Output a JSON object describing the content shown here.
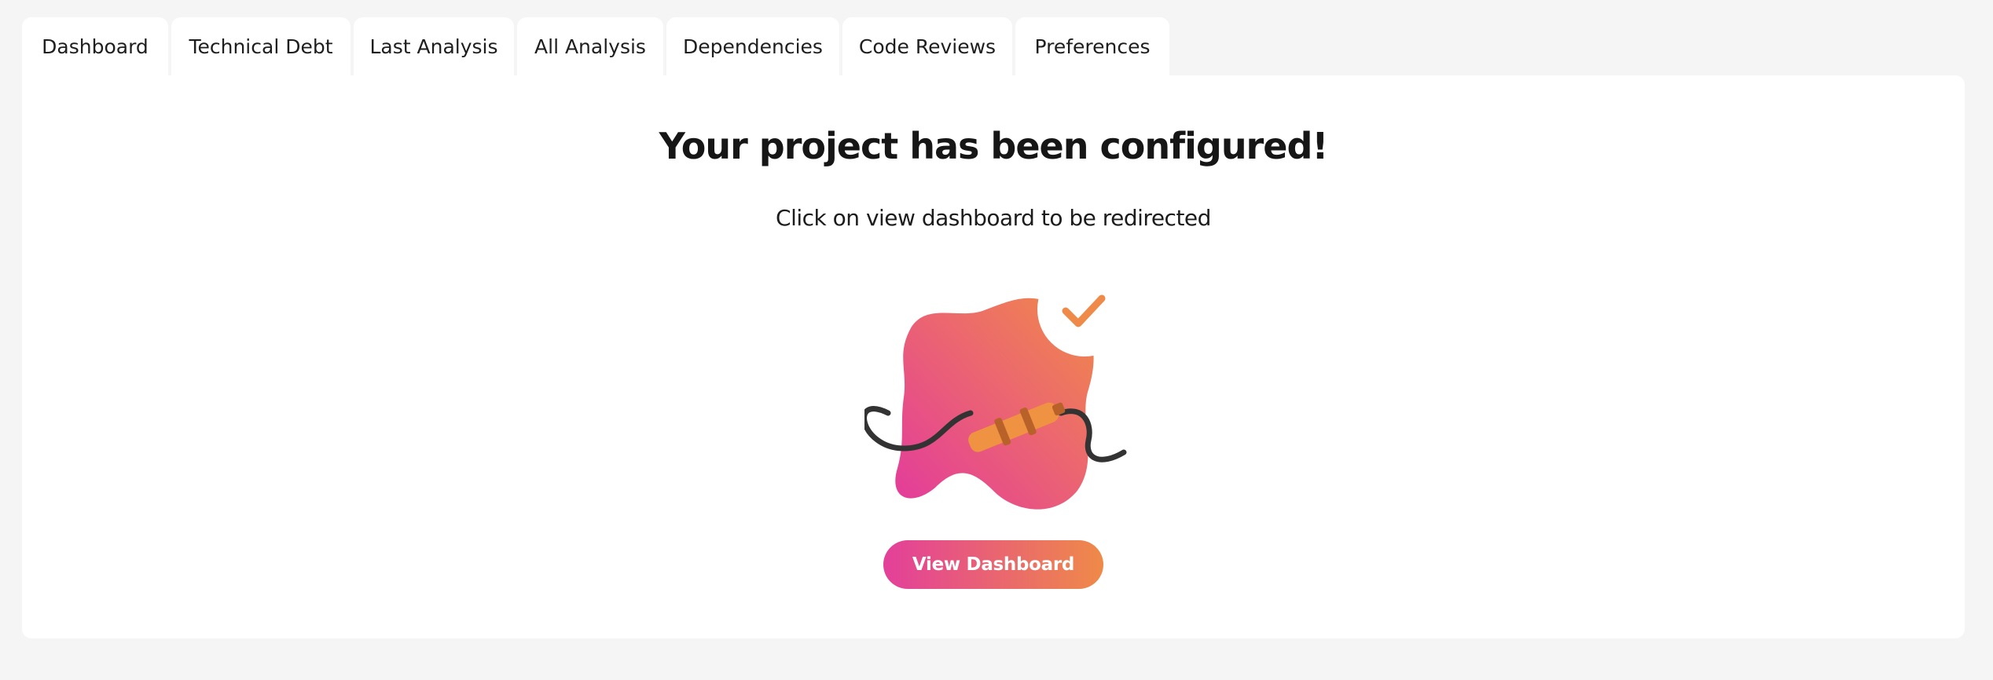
{
  "tabs": [
    {
      "label": "Dashboard"
    },
    {
      "label": "Technical Debt"
    },
    {
      "label": "Last Analysis"
    },
    {
      "label": "All Analysis"
    },
    {
      "label": "Dependencies"
    },
    {
      "label": "Code Reviews"
    },
    {
      "label": "Preferences"
    }
  ],
  "main": {
    "title": "Your project has been configured!",
    "subtitle": "Click on view dashboard to be redirected",
    "button_label": "View Dashboard"
  },
  "illustration": {
    "icon": "plugged-cable-checkmark-icon"
  },
  "colors": {
    "page_background": "#f5f5f5",
    "panel_background": "#ffffff",
    "gradient_start": "#e33f9a",
    "gradient_end": "#ef8a48",
    "check_color": "#ef8a48",
    "cable_color": "#333333"
  }
}
